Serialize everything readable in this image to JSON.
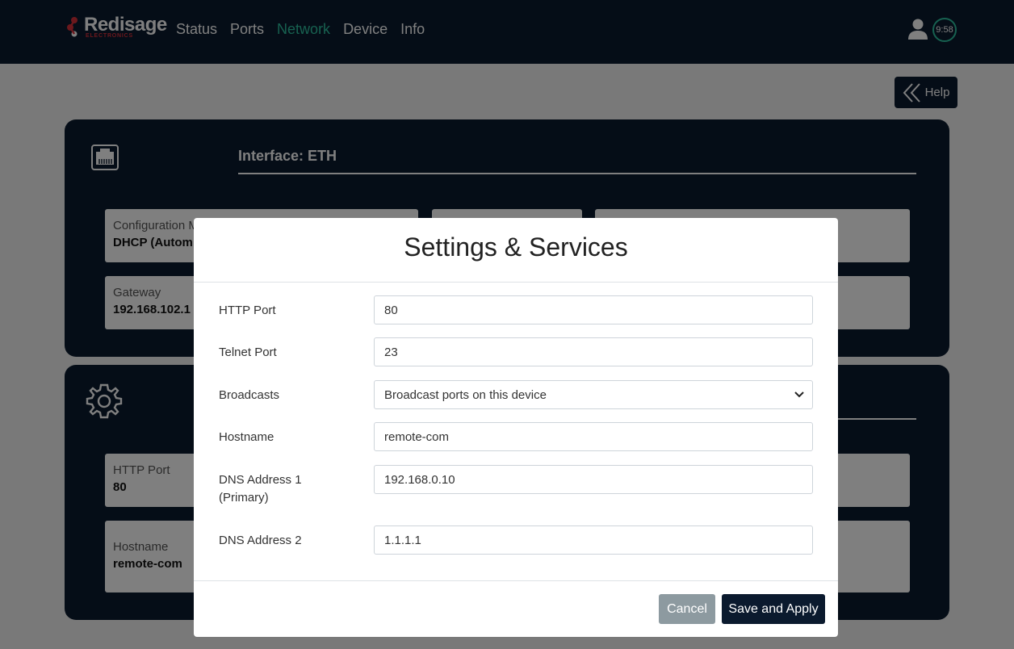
{
  "brand": {
    "name": "Redisage",
    "sub": "ELECTRONICS"
  },
  "nav": [
    {
      "label": "Status",
      "active": false
    },
    {
      "label": "Ports",
      "active": false
    },
    {
      "label": "Network",
      "active": true
    },
    {
      "label": "Device",
      "active": false
    },
    {
      "label": "Info",
      "active": false
    }
  ],
  "session": {
    "timer": "9:58"
  },
  "help": {
    "label": "Help"
  },
  "card1": {
    "title": "Interface: ETH",
    "config_label": "Configuration M",
    "config_value": "DHCP (Autom",
    "gateway_label": "Gateway",
    "gateway_value": "192.168.102.1"
  },
  "card2": {
    "http_label": "HTTP Port",
    "http_value": "80",
    "hostname_label": "Hostname",
    "hostname_value": "remote-com"
  },
  "modal": {
    "title": "Settings & Services",
    "fields": {
      "http_port": {
        "label": "HTTP Port",
        "value": "80"
      },
      "telnet_port": {
        "label": "Telnet Port",
        "value": "23"
      },
      "broadcasts": {
        "label": "Broadcasts",
        "value": "Broadcast ports on this device"
      },
      "hostname": {
        "label": "Hostname",
        "value": "remote-com"
      },
      "dns1": {
        "label_line1": "DNS Address 1",
        "label_line2": "(Primary)",
        "value": "192.168.0.10"
      },
      "dns2": {
        "label": "DNS Address 2",
        "value": "1.1.1.1"
      }
    },
    "cancel_label": "Cancel",
    "save_label": "Save and Apply"
  },
  "colors": {
    "navy": "#0b1a2e",
    "accent": "#2fc2a0",
    "cancel": "#8d9aa0",
    "brand_red": "#d6303a"
  }
}
